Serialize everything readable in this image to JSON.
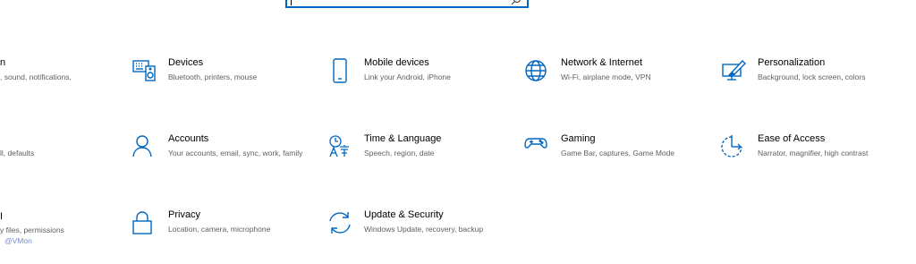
{
  "search": {
    "placeholder": ""
  },
  "left_column": {
    "row1_title": "n",
    "row1_desc": ", sound, notifications,",
    "row2_desc": "ll, defaults",
    "row3_title": "I",
    "row3_desc": "y files, permissions",
    "watermark": "@VMon"
  },
  "tiles": [
    {
      "title": "Devices",
      "desc": "Bluetooth, printers, mouse",
      "icon": "devices-icon"
    },
    {
      "title": "Mobile devices",
      "desc": "Link your Android, iPhone",
      "icon": "phone-icon"
    },
    {
      "title": "Network & Internet",
      "desc": "Wi-Fi, airplane mode, VPN",
      "icon": "globe-icon"
    },
    {
      "title": "Personalization",
      "desc": "Background, lock screen, colors",
      "icon": "paintbrush-icon"
    },
    {
      "title": "Accounts",
      "desc": "Your accounts, email, sync, work, family",
      "icon": "person-icon"
    },
    {
      "title": "Time & Language",
      "desc": "Speech, region, date",
      "icon": "time-language-icon"
    },
    {
      "title": "Gaming",
      "desc": "Game Bar, captures, Game Mode",
      "icon": "gamepad-icon"
    },
    {
      "title": "Ease of Access",
      "desc": "Narrator, magnifier, high contrast",
      "icon": "ease-of-access-icon"
    },
    {
      "title": "Privacy",
      "desc": "Location, camera, microphone",
      "icon": "lock-icon"
    },
    {
      "title": "Update & Security",
      "desc": "Windows Update, recovery, backup",
      "icon": "sync-icon"
    }
  ],
  "colors": {
    "accent": "#0067c0",
    "desc_text": "#5f5f5f"
  }
}
